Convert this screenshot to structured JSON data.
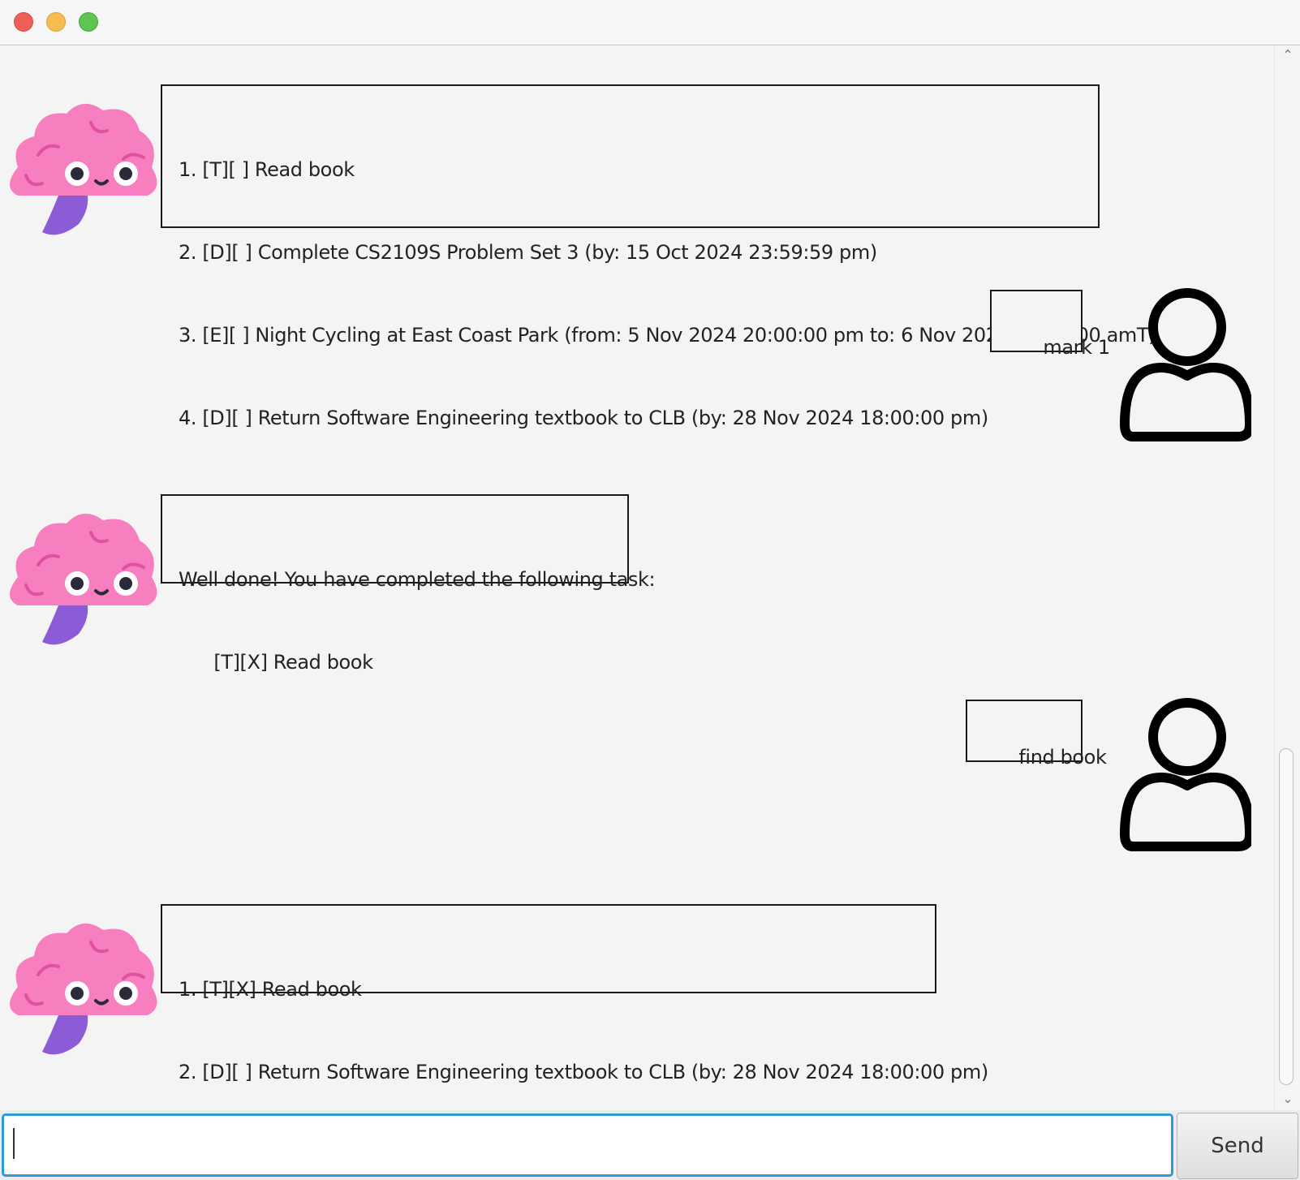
{
  "window": {
    "controls": [
      "close",
      "minimize",
      "zoom"
    ]
  },
  "messages": [
    {
      "sender": "bot",
      "lines": [
        "1. [T][ ] Read book",
        "2. [D][ ] Complete CS2109S Problem Set 3 (by: 15 Oct 2024 23:59:59 pm)",
        "3. [E][ ] Night Cycling at East Coast Park (from: 5 Nov 2024 20:00:00 pm to: 6 Nov 2024 06:00:00 amT)",
        "4. [D][ ] Return Software Engineering textbook to CLB (by: 28 Nov 2024 18:00:00 pm)"
      ]
    },
    {
      "sender": "user",
      "text": "mark 1"
    },
    {
      "sender": "bot",
      "lines": [
        "Well done! You have completed the following task:",
        "      [T][X] Read book"
      ]
    },
    {
      "sender": "user",
      "text": "find book"
    },
    {
      "sender": "bot",
      "lines": [
        "1. [T][X] Read book",
        "2. [D][ ] Return Software Engineering textbook to CLB (by: 28 Nov 2024 18:00:00 pm)"
      ]
    }
  ],
  "input": {
    "value": "",
    "placeholder": ""
  },
  "send_button": {
    "label": "Send"
  },
  "icons": {
    "bot_avatar": "brain-mascot-icon",
    "user_avatar": "user-outline-icon"
  },
  "colors": {
    "input_focus": "#2c9bd6",
    "brain_pink": "#f77fc0",
    "close": "#ee5f57",
    "minimize": "#f5bd4f",
    "zoom": "#5ec453"
  }
}
